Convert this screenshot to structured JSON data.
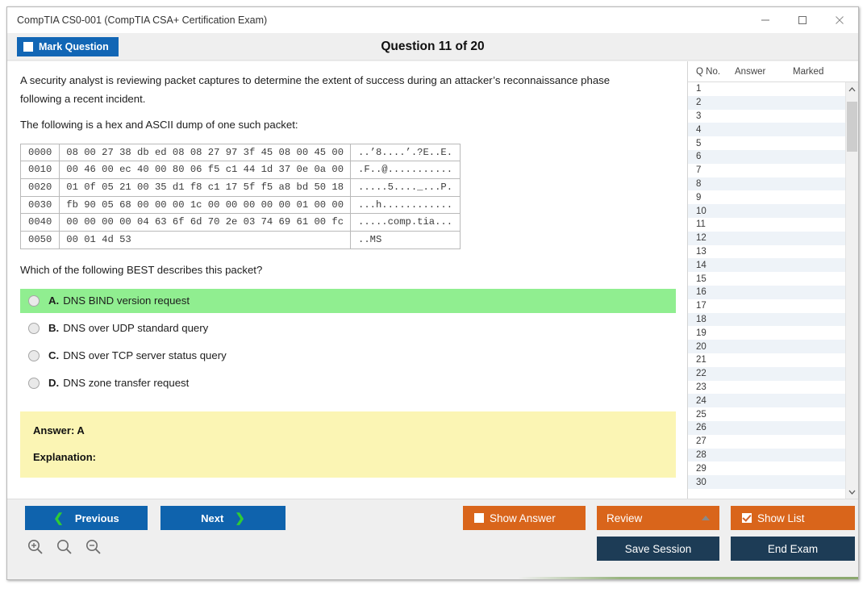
{
  "window": {
    "title": "CompTIA CS0-001 (CompTIA CSA+ Certification Exam)",
    "minimize_label": "minimize",
    "maximize_label": "maximize",
    "close_label": "close"
  },
  "toolbar": {
    "mark_question_label": "Mark Question",
    "mark_question_checked": false,
    "question_title": "Question 11 of 20"
  },
  "question": {
    "intro_line1": "A security analyst is reviewing packet captures to determine the extent of success during an attacker’s reconnaissance phase",
    "intro_line2": "following a recent incident.",
    "intro_line3": "The following is a hex and ASCII dump of one such packet:",
    "prompt": "Which of the following BEST describes this packet?"
  },
  "hexdump": {
    "rows": [
      {
        "offset": "0000",
        "hex": "08 00 27 38 db ed 08 08 27 97 3f 45 08 00 45 00",
        "ascii": "..’8....’.?E..E."
      },
      {
        "offset": "0010",
        "hex": "00 46 00 ec 40 00 80 06 f5 c1 44 1d 37 0e 0a 00",
        "ascii": ".F..@..........."
      },
      {
        "offset": "0020",
        "hex": "01 0f 05 21 00 35 d1 f8 c1 17 5f f5 a8 bd 50 18",
        "ascii": ".....5...._...P."
      },
      {
        "offset": "0030",
        "hex": "fb 90 05 68 00 00 00 1c 00 00 00 00 00 01 00 00",
        "ascii": "...h............"
      },
      {
        "offset": "0040",
        "hex": "00 00 00 00 04 63 6f 6d 70 2e 03 74 69 61 00 fc",
        "ascii": ".....comp.tia..."
      },
      {
        "offset": "0050",
        "hex": "00 01 4d 53",
        "ascii": "..MS"
      }
    ]
  },
  "options": [
    {
      "letter": "A.",
      "text": "DNS BIND version request",
      "highlighted": true,
      "selected": false
    },
    {
      "letter": "B.",
      "text": "DNS over UDP standard query",
      "highlighted": false,
      "selected": false
    },
    {
      "letter": "C.",
      "text": "DNS over TCP server status query",
      "highlighted": false,
      "selected": false
    },
    {
      "letter": "D.",
      "text": "DNS zone transfer request",
      "highlighted": false,
      "selected": false
    }
  ],
  "answer_panel": {
    "answer_label": "Answer: A",
    "explanation_label": "Explanation:"
  },
  "question_list": {
    "columns": [
      "Q No.",
      "Answer",
      "Marked"
    ],
    "rows": [
      {
        "no": "1",
        "answer": "",
        "marked": ""
      },
      {
        "no": "2",
        "answer": "",
        "marked": ""
      },
      {
        "no": "3",
        "answer": "",
        "marked": ""
      },
      {
        "no": "4",
        "answer": "",
        "marked": ""
      },
      {
        "no": "5",
        "answer": "",
        "marked": ""
      },
      {
        "no": "6",
        "answer": "",
        "marked": ""
      },
      {
        "no": "7",
        "answer": "",
        "marked": ""
      },
      {
        "no": "8",
        "answer": "",
        "marked": ""
      },
      {
        "no": "9",
        "answer": "",
        "marked": ""
      },
      {
        "no": "10",
        "answer": "",
        "marked": ""
      },
      {
        "no": "11",
        "answer": "",
        "marked": ""
      },
      {
        "no": "12",
        "answer": "",
        "marked": ""
      },
      {
        "no": "13",
        "answer": "",
        "marked": ""
      },
      {
        "no": "14",
        "answer": "",
        "marked": ""
      },
      {
        "no": "15",
        "answer": "",
        "marked": ""
      },
      {
        "no": "16",
        "answer": "",
        "marked": ""
      },
      {
        "no": "17",
        "answer": "",
        "marked": ""
      },
      {
        "no": "18",
        "answer": "",
        "marked": ""
      },
      {
        "no": "19",
        "answer": "",
        "marked": ""
      },
      {
        "no": "20",
        "answer": "",
        "marked": ""
      },
      {
        "no": "21",
        "answer": "",
        "marked": ""
      },
      {
        "no": "22",
        "answer": "",
        "marked": ""
      },
      {
        "no": "23",
        "answer": "",
        "marked": ""
      },
      {
        "no": "24",
        "answer": "",
        "marked": ""
      },
      {
        "no": "25",
        "answer": "",
        "marked": ""
      },
      {
        "no": "26",
        "answer": "",
        "marked": ""
      },
      {
        "no": "27",
        "answer": "",
        "marked": ""
      },
      {
        "no": "28",
        "answer": "",
        "marked": ""
      },
      {
        "no": "29",
        "answer": "",
        "marked": ""
      },
      {
        "no": "30",
        "answer": "",
        "marked": ""
      }
    ]
  },
  "footer": {
    "previous_label": "Previous",
    "next_label": "Next",
    "show_answer_label": "Show Answer",
    "show_answer_checked": false,
    "review_label": "Review",
    "show_list_label": "Show List",
    "show_list_checked": true,
    "save_session_label": "Save Session",
    "end_exam_label": "End Exam",
    "zoom_in_label": "zoom-in",
    "zoom_reset_label": "zoom-reset",
    "zoom_out_label": "zoom-out"
  },
  "colors": {
    "accent_blue": "#0f63ad",
    "accent_orange": "#d9651b",
    "accent_navy": "#1d3c56",
    "correct_green": "#90ee90",
    "answer_yellow": "#fbf5b4",
    "chevron_green": "#2fcc35"
  }
}
